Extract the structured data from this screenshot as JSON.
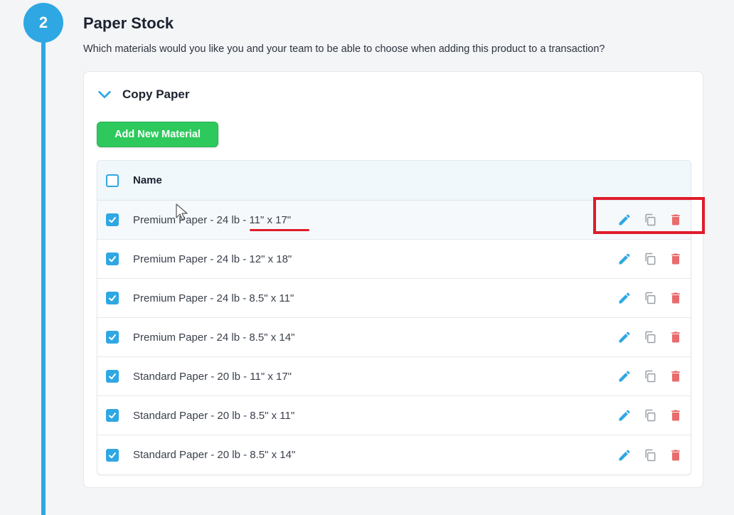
{
  "step": {
    "number": "2"
  },
  "section": {
    "title": "Paper Stock",
    "description": "Which materials would you like you and your team to be able to choose when adding this product to a transaction?"
  },
  "group": {
    "title": "Copy Paper"
  },
  "buttons": {
    "add_material": "Add New Material"
  },
  "table": {
    "header": {
      "name": "Name"
    },
    "rows": [
      {
        "name": "Premium Paper - 24 lb - 11\" x 17\""
      },
      {
        "name": "Premium Paper - 24 lb - 12\" x 18\""
      },
      {
        "name": "Premium Paper - 24 lb - 8.5\" x 11\""
      },
      {
        "name": "Premium Paper - 24 lb - 8.5\" x 14\""
      },
      {
        "name": "Standard Paper - 20 lb - 11\" x 17\""
      },
      {
        "name": "Standard Paper - 20 lb - 8.5\" x 11\""
      },
      {
        "name": "Standard Paper - 20 lb - 8.5\" x 14\""
      }
    ]
  },
  "icons": {
    "edit": "pencil-icon",
    "duplicate": "copy-icon",
    "delete": "trash-icon",
    "collapse": "chevron-down-icon",
    "checkbox": "checkmark-icon"
  },
  "colors": {
    "accent": "#2fa7e3",
    "add_button": "#2ec95c",
    "delete": "#e96b6b",
    "duplicate": "#9aa0a6",
    "annotation": "#e01b2a"
  }
}
